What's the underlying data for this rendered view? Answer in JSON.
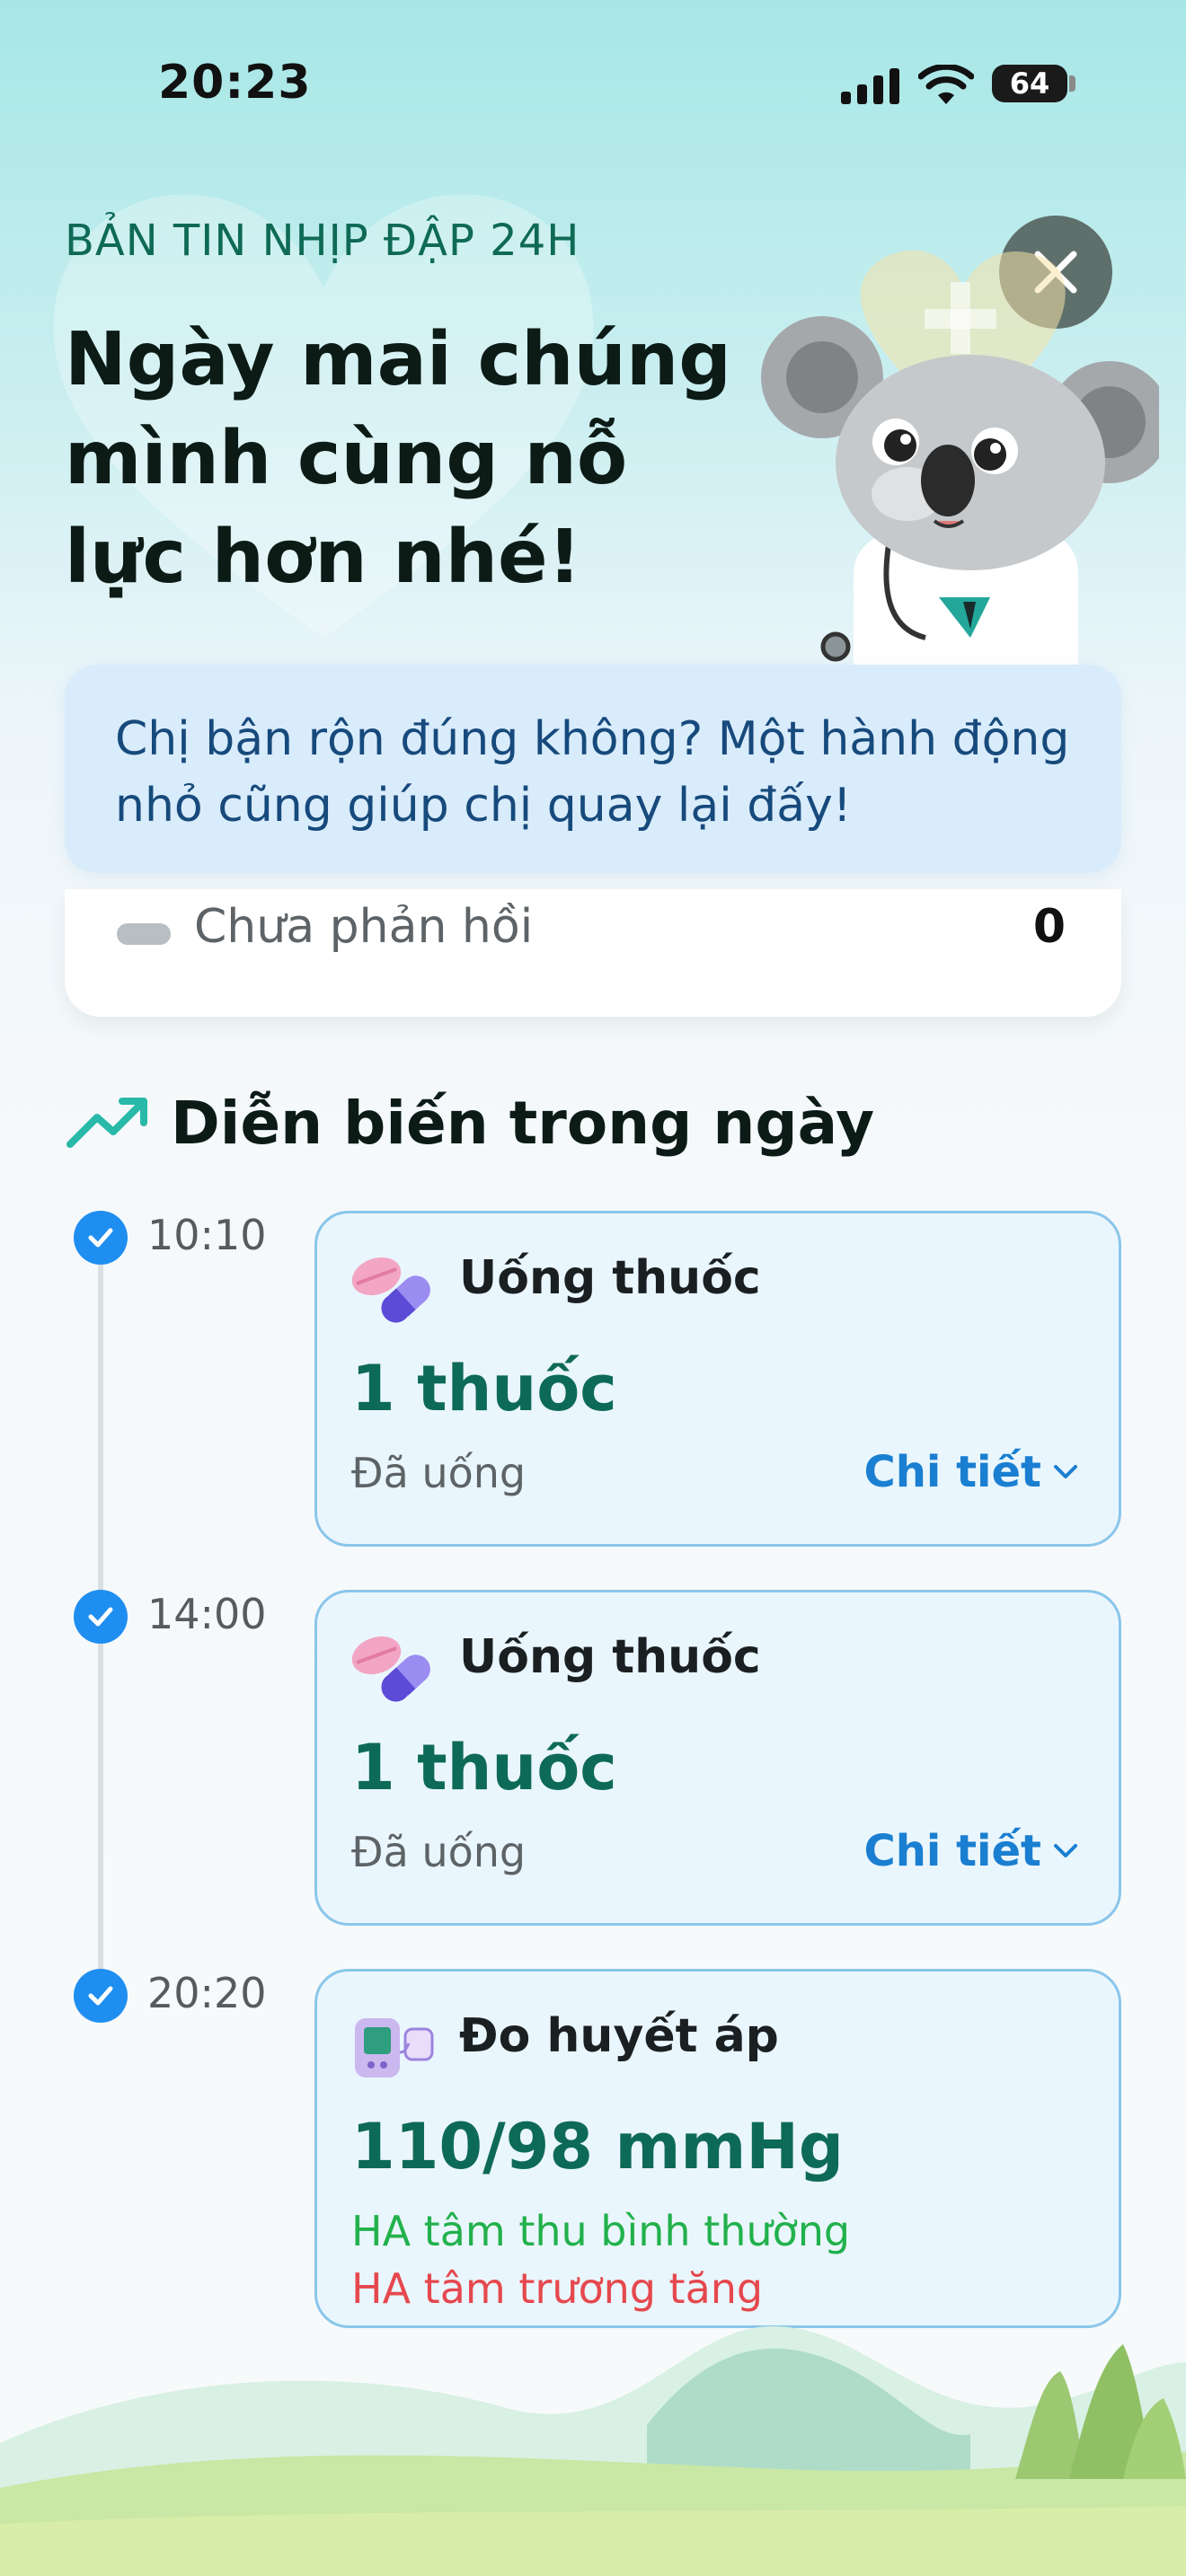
{
  "status_bar": {
    "time": "20:23",
    "battery": "64"
  },
  "header": {
    "eyebrow": "BẢN TIN NHỊP ĐẬP 24H",
    "headline": "Ngày mai chúng mình cùng nỗ lực hơn nhé!"
  },
  "tip": {
    "text": "Chị bận rộn đúng không? Một hành động nhỏ cũng giúp chị quay lại đấy!"
  },
  "summary": {
    "label": "Chưa phản hồi",
    "value": "0"
  },
  "section": {
    "title": "Diễn biến trong ngày",
    "icon": "trend-up-icon"
  },
  "timeline": [
    {
      "time": "10:10",
      "icon": "pill-icon",
      "title": "Uống thuốc",
      "value": "1 thuốc",
      "status": "Đã uống",
      "link": "Chi tiết"
    },
    {
      "time": "14:00",
      "icon": "pill-icon",
      "title": "Uống thuốc",
      "value": "1 thuốc",
      "status": "Đã uống",
      "link": "Chi tiết"
    },
    {
      "time": "20:20",
      "icon": "blood-pressure-monitor-icon",
      "title": "Đo huyết áp",
      "value": "110/98 mmHg",
      "notes": [
        {
          "text": "HA tâm thu bình thường",
          "color": "#22b14c"
        },
        {
          "text": "HA tâm trương tăng",
          "color": "#e5484d"
        }
      ]
    }
  ],
  "colors": {
    "accent": "#1f8ef1",
    "value_green": "#0e6a58",
    "link_blue": "#1a7fd1"
  }
}
